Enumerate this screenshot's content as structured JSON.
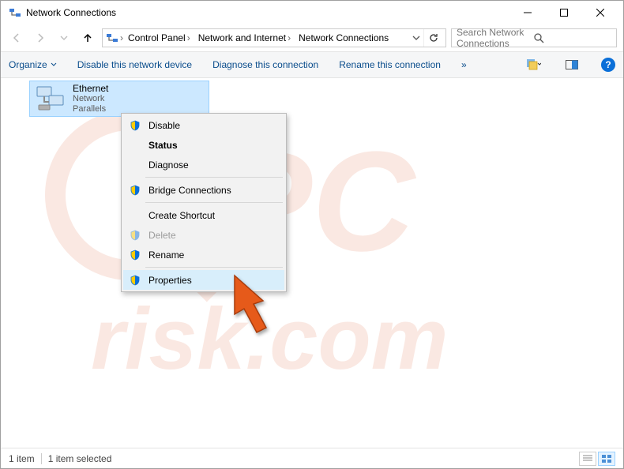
{
  "window": {
    "title": "Network Connections"
  },
  "breadcrumb": [
    {
      "label": "Control Panel"
    },
    {
      "label": "Network and Internet"
    },
    {
      "label": "Network Connections"
    }
  ],
  "search": {
    "placeholder": "Search Network Connections"
  },
  "toolbar": {
    "organize": "Organize",
    "disable": "Disable this network device",
    "diagnose": "Diagnose this connection",
    "rename": "Rename this connection",
    "more": "»",
    "help": "?"
  },
  "adapter": {
    "name": "Ethernet",
    "status": "Network",
    "device_prefix": "Parallels"
  },
  "context_menu": [
    {
      "label": "Disable",
      "shield": true
    },
    {
      "label": "Status",
      "bold": true
    },
    {
      "label": "Diagnose"
    },
    {
      "sep": true
    },
    {
      "label": "Bridge Connections",
      "shield": true
    },
    {
      "sep": true
    },
    {
      "label": "Create Shortcut"
    },
    {
      "label": "Delete",
      "shield": true,
      "disabled": true
    },
    {
      "label": "Rename",
      "shield": true
    },
    {
      "sep": true
    },
    {
      "label": "Properties",
      "shield": true,
      "hover": true
    }
  ],
  "statusbar": {
    "count": "1 item",
    "selected": "1 item selected"
  }
}
